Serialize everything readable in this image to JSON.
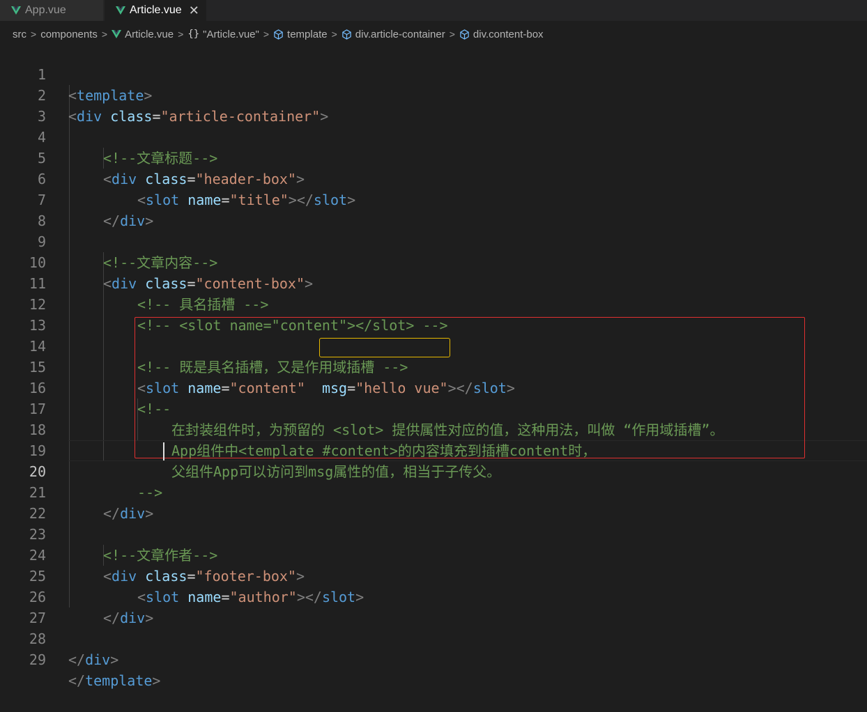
{
  "tabs": [
    {
      "label": "App.vue",
      "active": false
    },
    {
      "label": "Article.vue",
      "active": true,
      "close": "✕"
    }
  ],
  "breadcrumb": {
    "items": [
      "src",
      "components",
      "Article.vue",
      "{}",
      "\"Article.vue\"",
      "template",
      "div.article-container",
      "div.content-box"
    ],
    "separator": ">"
  },
  "editor": {
    "current_line": 20,
    "line_numbers": [
      "1",
      "2",
      "3",
      "4",
      "5",
      "6",
      "7",
      "8",
      "9",
      "10",
      "11",
      "12",
      "13",
      "14",
      "15",
      "16",
      "17",
      "18",
      "19",
      "20",
      "21",
      "22",
      "23",
      "24",
      "25",
      "26",
      "27",
      "28",
      "29"
    ],
    "lines": {
      "l1": {
        "open": "<",
        "tag": "template",
        "close": ">"
      },
      "l2": {
        "open": "<",
        "tag": "div",
        "attr": "class",
        "eq": "=",
        "val": "\"article-container\"",
        "close": ">"
      },
      "l4": {
        "comment": "<!--文章标题-->"
      },
      "l5": {
        "open": "<",
        "tag": "div",
        "attr": "class",
        "eq": "=",
        "val": "\"header-box\"",
        "close": ">"
      },
      "l6": {
        "open": "<",
        "tag": "slot",
        "attr": "name",
        "eq": "=",
        "val": "\"title\"",
        "close": "></",
        "tag2": "slot",
        "close2": ">"
      },
      "l7": {
        "open": "</",
        "tag": "div",
        "close": ">"
      },
      "l9": {
        "comment": "<!--文章内容-->"
      },
      "l10": {
        "open": "<",
        "tag": "div",
        "attr": "class",
        "eq": "=",
        "val": "\"content-box\"",
        "close": ">"
      },
      "l11": {
        "comment": "<!-- 具名插槽 -->"
      },
      "l12": {
        "comment": "<!-- <slot name=\"content\"></slot> -->"
      },
      "l14": {
        "comment": "<!-- 既是具名插槽，又是作用域插槽 -->"
      },
      "l15": {
        "open": "<",
        "tag": "slot",
        "attr": "name",
        "eq": "=",
        "val": "\"content\"",
        "space": " ",
        "attr2": "msg",
        "eq2": "=",
        "val2": "\"hello vue\"",
        "close": "></",
        "tag2": "slot",
        "close2": ">"
      },
      "l16": {
        "comment": "<!--"
      },
      "l17": {
        "comment": "在封装组件时，为预留的 <slot> 提供属性对应的值，这种用法，叫做 “作用域插槽”。"
      },
      "l18": {
        "comment": "App组件中<template #content>的内容填充到插槽content时，"
      },
      "l19": {
        "comment": "父组件App可以访问到msg属性的值，相当于子传父。"
      },
      "l20": {
        "comment": "-->"
      },
      "l21": {
        "open": "</",
        "tag": "div",
        "close": ">"
      },
      "l23": {
        "comment": "<!--文章作者-->"
      },
      "l24": {
        "open": "<",
        "tag": "div",
        "attr": "class",
        "eq": "=",
        "val": "\"footer-box\"",
        "close": ">"
      },
      "l25": {
        "open": "<",
        "tag": "slot",
        "attr": "name",
        "eq": "=",
        "val": "\"author\"",
        "close": "></",
        "tag2": "slot",
        "close2": ">"
      },
      "l26": {
        "open": "</",
        "tag": "div",
        "close": ">"
      },
      "l28": {
        "open": "</",
        "tag": "div",
        "close": ">"
      },
      "l29": {
        "open": "</",
        "tag": "template",
        "close": ">"
      }
    }
  },
  "colors": {
    "background": "#1e1e1e",
    "tag": "#569cd6",
    "attribute": "#9cdcfe",
    "string": "#ce9178",
    "comment": "#6a9955",
    "punctuation": "#808080",
    "highlight_red": "#e03030",
    "highlight_yellow": "#e6b800",
    "vue_green": "#41b883"
  }
}
